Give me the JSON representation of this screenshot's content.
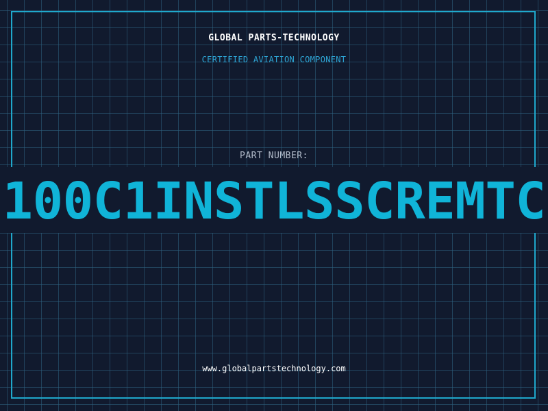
{
  "header": {
    "company": "GLOBAL PARTS-TECHNOLOGY",
    "tagline": "CERTIFIED AVIATION COMPONENT"
  },
  "part": {
    "label": "PART NUMBER:",
    "number": "100C1INSTLSSCREMTC"
  },
  "footer": {
    "website": "www.globalpartstechnology.com"
  },
  "colors": {
    "background": "#111a2e",
    "grid": "#2e6282",
    "frame": "#1fa8cc",
    "accent": "#10b4d8",
    "tagline": "#2ea6d6",
    "label": "#b3bccb",
    "text": "#ffffff"
  }
}
